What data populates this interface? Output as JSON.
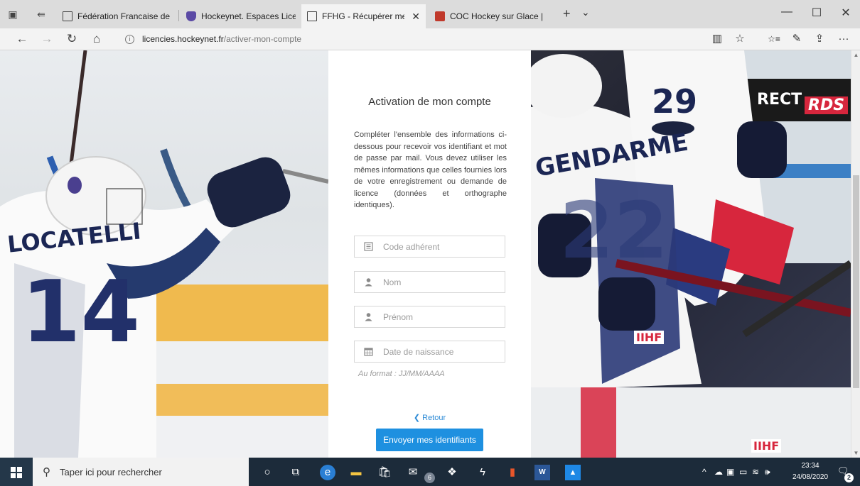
{
  "browser": {
    "tabs": [
      {
        "label": "Fédération Francaise de Hoc",
        "icon": "page-icon"
      },
      {
        "label": "Hockeynet. Espaces Licencié",
        "icon": "shield-icon"
      },
      {
        "label": "FFHG - Récupérer mes i",
        "icon": "page-icon",
        "active": true
      },
      {
        "label": "COC Hockey sur Glace | Les",
        "icon": "coc-icon"
      }
    ],
    "close_tab_glyph": "✕",
    "new_tab_glyph": "+",
    "tab_list_glyph": "⌄",
    "window_controls": {
      "minimize": "—",
      "maximize": "☐",
      "close": "✕"
    },
    "url": {
      "host": "licencies.hockeynet.fr",
      "path": "/activer-mon-compte"
    },
    "nav": {
      "back": "←",
      "forward": "→",
      "refresh": "↻",
      "home": "⌂"
    },
    "tools": {
      "reading": "📖",
      "favorite": "☆",
      "favorites_list": "☆≡",
      "notes": "✎",
      "share": "⇪",
      "more": "···"
    }
  },
  "page": {
    "title": "Activation de mon compte",
    "description": "Compléter l'ensemble des informations ci-dessous pour recevoir vos identifiant et mot de passe par mail. Vous devez utiliser les mêmes informations que celles fournies lors de votre enregistrement ou demande de licence (données et orthographe identiques).",
    "fields": {
      "code": {
        "placeholder": "Code adhérent",
        "icon": "id-card-icon"
      },
      "nom": {
        "placeholder": "Nom",
        "icon": "user-icon"
      },
      "prenom": {
        "placeholder": "Prénom",
        "icon": "user-icon"
      },
      "naissance": {
        "placeholder": "Date de naissance",
        "icon": "calendar-icon"
      }
    },
    "format_hint": "Au format : JJ/MM/AAAA",
    "back_label": "Retour",
    "submit_label": "Envoyer mes identifiants",
    "photo_left_text": {
      "name": "LOCATELLI",
      "number": "14"
    },
    "photo_right_text": {
      "name": "GENDARME",
      "number_top": "29",
      "number_main": "22",
      "sponsor1": "RECT",
      "sponsor2": "RDS",
      "logo": "IIHF"
    }
  },
  "taskbar": {
    "search_placeholder": "Taper ici pour rechercher",
    "mail_badge": "6",
    "time": "23:34",
    "date": "24/08/2020",
    "notification_count": "2"
  },
  "colors": {
    "accent": "#1e90e0",
    "taskbar": "#1c2b3a"
  }
}
